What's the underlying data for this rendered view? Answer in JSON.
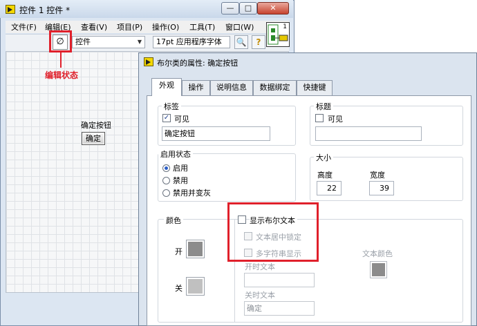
{
  "main_window": {
    "title": "控件 1 控件 *",
    "window_buttons": {
      "minimize": "—",
      "maximize": "□",
      "close": "✕"
    },
    "menu": [
      "文件(F)",
      "编辑(E)",
      "查看(V)",
      "项目(P)",
      "操作(O)",
      "工具(T)",
      "窗口(W)"
    ],
    "toolbar": {
      "edit_mode_glyph": "∅",
      "control_combo": "控件",
      "font_combo": "17pt 应用程序字体",
      "search_glyph": "🔍",
      "help_glyph": "?",
      "connector_number": "1"
    },
    "annotation_label": "编辑状态",
    "boolean_caption": "确定按钮",
    "boolean_button_text": "确定"
  },
  "dialog": {
    "title": "布尔类的属性: 确定按钮",
    "tabs": [
      "外观",
      "操作",
      "说明信息",
      "数据绑定",
      "快捷键"
    ],
    "active_tab": "外观",
    "label_group": {
      "legend": "标签",
      "visible_label": "可见",
      "visible_checked": true,
      "checkmark": "✓",
      "value": "确定按钮"
    },
    "caption_group": {
      "legend": "标题",
      "visible_label": "可见",
      "visible_checked": false,
      "value": ""
    },
    "enable_group": {
      "legend": "启用状态",
      "options": [
        "启用",
        "禁用",
        "禁用并变灰"
      ],
      "selected": "启用"
    },
    "size_group": {
      "legend": "大小",
      "height_label": "高度",
      "height_value": "22",
      "width_label": "宽度",
      "width_value": "39"
    },
    "color_group": {
      "legend": "颜色",
      "on_label": "开",
      "off_label": "关",
      "on_color": "#8c8c8c",
      "off_color": "#c0c0c0"
    },
    "bool_text": {
      "show_label": "显示布尔文本",
      "lock_center_label": "文本居中锁定",
      "multi_string_label": "多字符串显示",
      "on_text_label": "开时文本",
      "on_text_value": "",
      "off_text_label": "关时文本",
      "off_text_value": "确定",
      "text_color_label": "文本颜色",
      "text_color": "#8c8c8c"
    }
  },
  "colors": {
    "annotation_red": "#e0202b",
    "window_bg": "#dce6f2",
    "dialog_bg": "#dbe4ef"
  }
}
